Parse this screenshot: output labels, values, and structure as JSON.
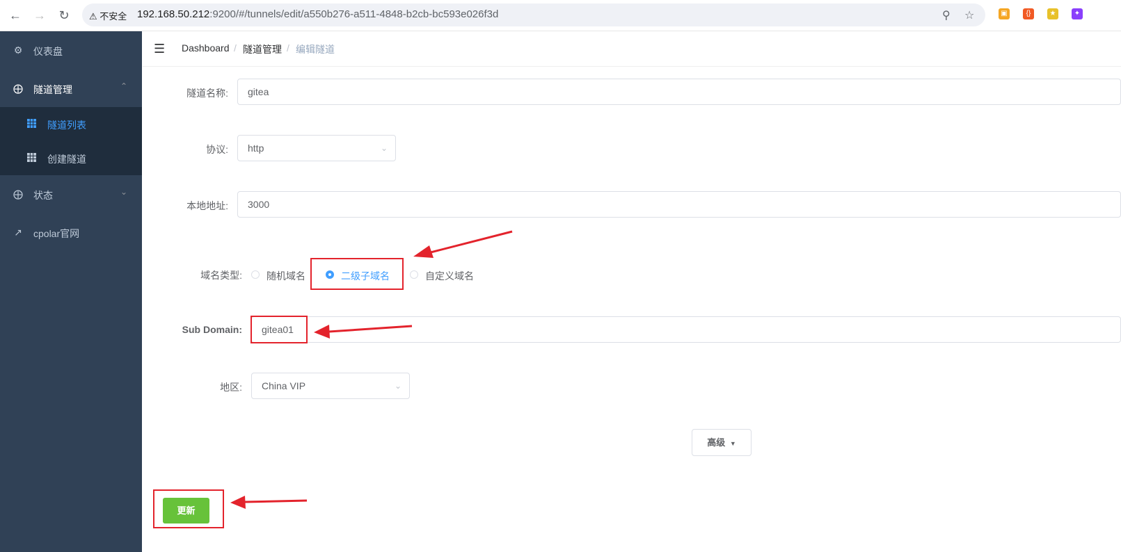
{
  "browser": {
    "insecure_label": "不安全",
    "url_host": "192.168.50.212",
    "url_path": ":9200/#/tunnels/edit/a550b276-a511-4848-b2cb-bc593e026f3d"
  },
  "sidebar": {
    "dashboard": "仪表盘",
    "tunnel_mgmt": "隧道管理",
    "tunnel_list": "隧道列表",
    "create_tunnel": "创建隧道",
    "status": "状态",
    "cpolar_site": "cpolar官网"
  },
  "breadcrumb": {
    "home": "Dashboard",
    "sep": "/",
    "section": "隧道管理",
    "current": "编辑隧道"
  },
  "form": {
    "name_label": "隧道名称:",
    "name_value": "gitea",
    "protocol_label": "协议:",
    "protocol_value": "http",
    "local_label": "本地地址:",
    "local_value": "3000",
    "domain_type_label": "域名类型:",
    "domain_options": [
      "随机域名",
      "二级子域名",
      "自定义域名"
    ],
    "domain_selected": "二级子域名",
    "subdomain_label": "Sub Domain:",
    "subdomain_value": "gitea01",
    "region_label": "地区:",
    "region_value": "China VIP",
    "advanced_label": "高级",
    "update_label": "更新"
  },
  "colors": {
    "sidebar_bg": "#304156",
    "submenu_bg": "#1f2d3d",
    "accent": "#409eff",
    "success": "#67c23a",
    "annotation": "#e3232c"
  }
}
